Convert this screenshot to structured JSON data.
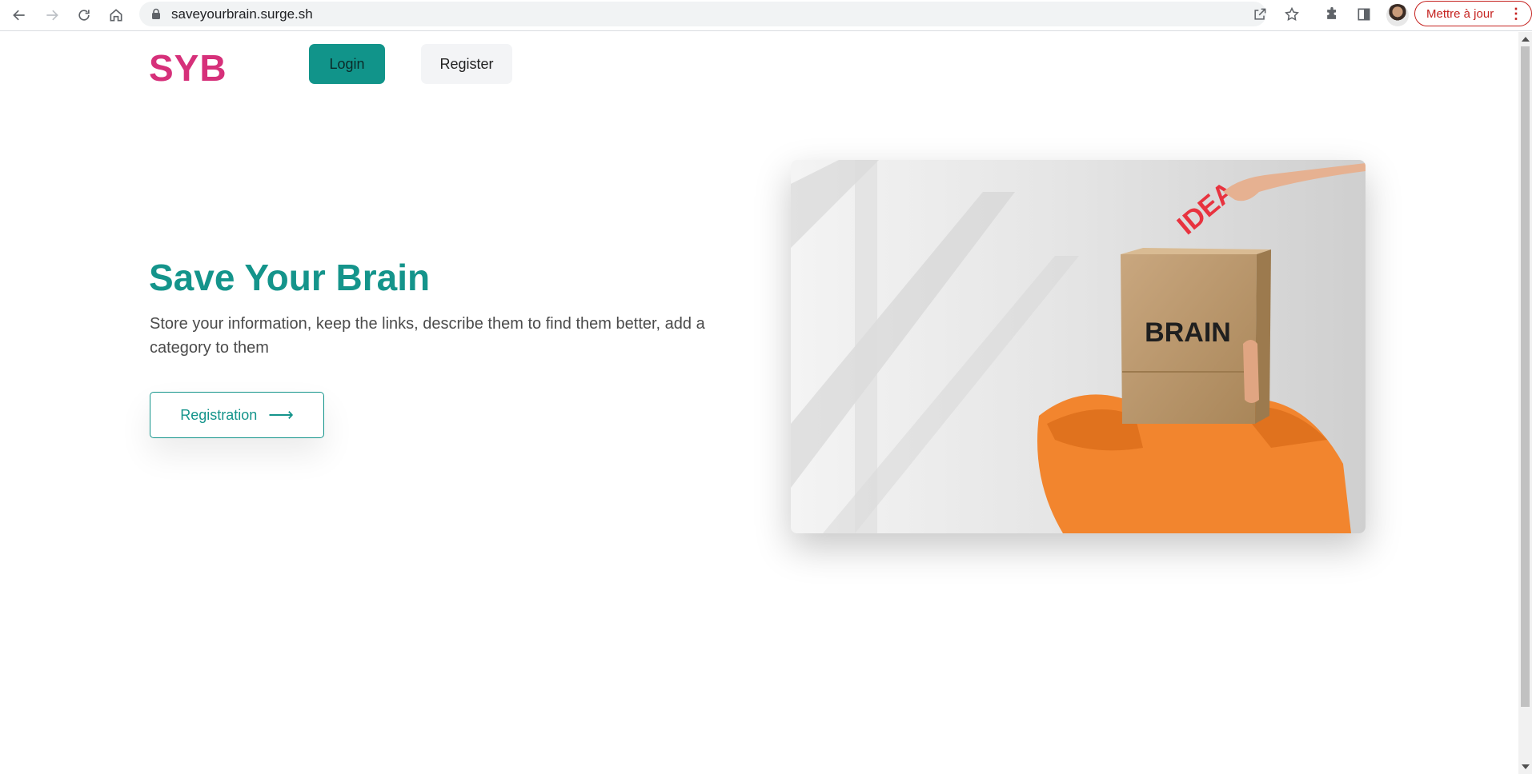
{
  "browser": {
    "url": "saveyourbrain.surge.sh",
    "update_label": "Mettre à jour",
    "menu_dots": "⋮"
  },
  "header": {
    "logo": "SYB",
    "login_label": "Login",
    "register_label": "Register"
  },
  "hero": {
    "title": "Save Your Brain",
    "description": "Store your information, keep the links, describe them to find them better, add a category to them",
    "cta_label": "Registration",
    "cta_arrow": "⟶"
  },
  "image": {
    "box_text": "BRAIN",
    "paper_text": "IDEA"
  },
  "colors": {
    "brand_pink": "#d6307a",
    "teal": "#14948b",
    "update_red": "#c5221f"
  }
}
